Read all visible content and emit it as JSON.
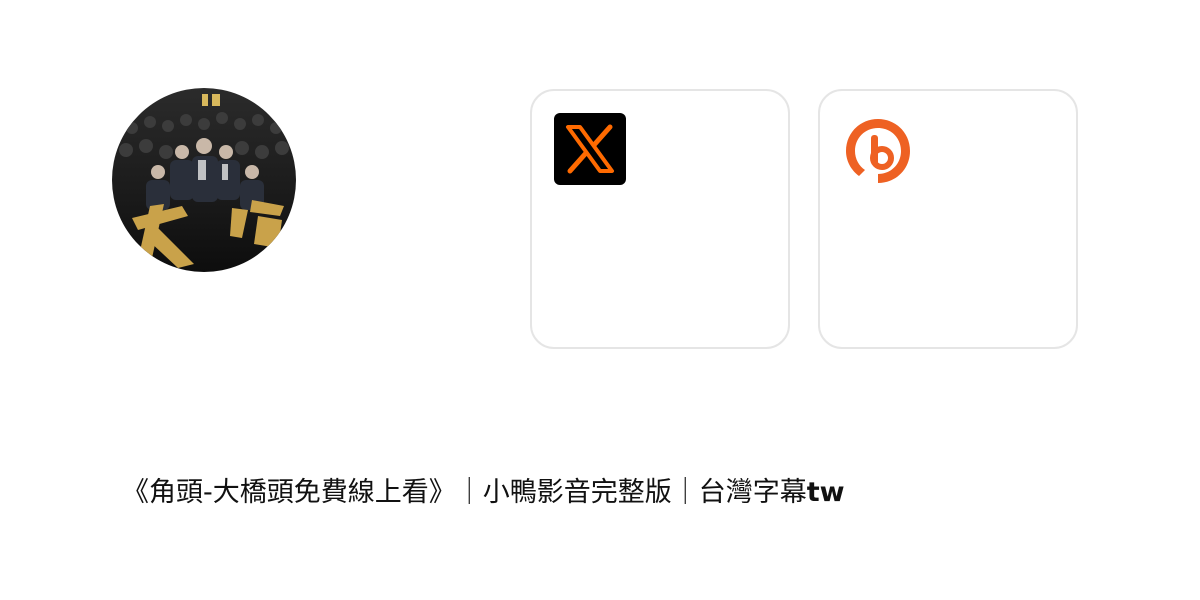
{
  "profile": {
    "avatar_icon": "movie-poster-avatar",
    "avatar_poster_text": "角頭"
  },
  "links": [
    {
      "icon": "x-logo-icon",
      "accent": "#ff6a00",
      "background": "#000000"
    },
    {
      "icon": "bitly-logo-icon",
      "accent": "#ee6123"
    }
  ],
  "title": {
    "main": "《角頭-大橋頭免費線上看》｜小鴨影音完整版｜台灣字幕",
    "suffix": "tw"
  }
}
